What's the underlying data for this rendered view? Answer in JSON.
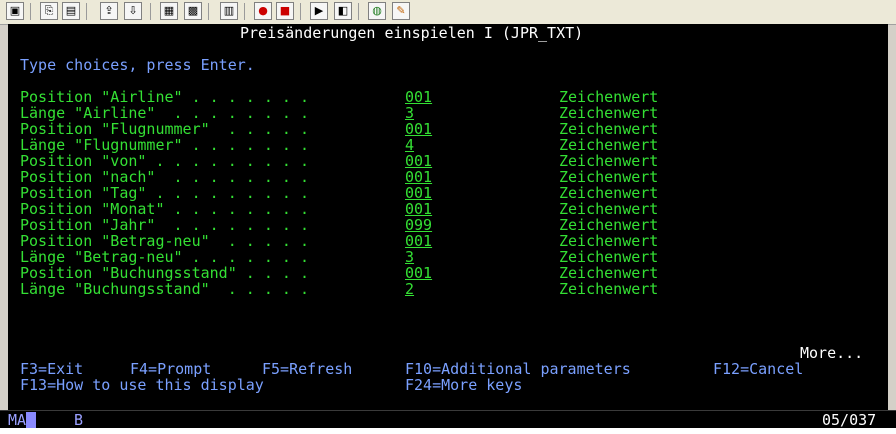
{
  "toolbar": {
    "icons": [
      "screen-icon",
      "copy-icon",
      "paste-icon",
      "transfer-send-icon",
      "transfer-receive-icon",
      "display-icon",
      "keyboard-icon",
      "chart-icon",
      "record-icon",
      "stop-icon",
      "play-icon",
      "macro-icon",
      "globe-icon",
      "pencil-icon"
    ]
  },
  "screen": {
    "title": "Preisänderungen einspielen I (JPR_TXT)",
    "instruction": "Type choices, press Enter.",
    "fields": [
      {
        "label": "Position \"Airline\" . . . . . . .",
        "value": "001",
        "hint": "Zeichenwert"
      },
      {
        "label": "Länge \"Airline\"  . . . . . . . .",
        "value": "3",
        "hint": "Zeichenwert"
      },
      {
        "label": "Position \"Flugnummer\"  . . . . .",
        "value": "001",
        "hint": "Zeichenwert"
      },
      {
        "label": "Länge \"Flugnummer\" . . . . . . .",
        "value": "4",
        "hint": "Zeichenwert"
      },
      {
        "label": "Position \"von\" . . . . . . . . .",
        "value": "001",
        "hint": "Zeichenwert"
      },
      {
        "label": "Position \"nach\"  . . . . . . . .",
        "value": "001",
        "hint": "Zeichenwert"
      },
      {
        "label": "Position \"Tag\" . . . . . . . . .",
        "value": "001",
        "hint": "Zeichenwert"
      },
      {
        "label": "Position \"Monat\" . . . . . . . .",
        "value": "001",
        "hint": "Zeichenwert"
      },
      {
        "label": "Position \"Jahr\"  . . . . . . . .",
        "value": "099",
        "hint": "Zeichenwert"
      },
      {
        "label": "Position \"Betrag-neu\"  . . . . .",
        "value": "001",
        "hint": "Zeichenwert"
      },
      {
        "label": "Länge \"Betrag-neu\" . . . . . . .",
        "value": "3",
        "hint": "Zeichenwert"
      },
      {
        "label": "Position \"Buchungsstand\" . . . .",
        "value": "001",
        "hint": "Zeichenwert"
      },
      {
        "label": "Länge \"Buchungsstand\"  . . . . .",
        "value": "2",
        "hint": "Zeichenwert"
      }
    ],
    "more": "More...",
    "fkeys_row1": [
      "F3=Exit",
      "F4=Prompt",
      "F5=Refresh",
      "F10=Additional parameters",
      "F12=Cancel"
    ],
    "fkeys_row2": [
      "F13=How to use this display",
      "F24=More keys"
    ]
  },
  "status": {
    "left": "MA",
    "mid": "B",
    "pos": "05/037"
  }
}
